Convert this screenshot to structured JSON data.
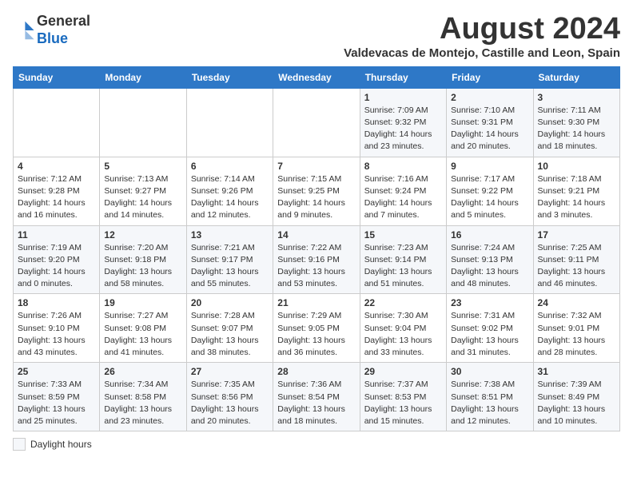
{
  "header": {
    "logo_general": "General",
    "logo_blue": "Blue",
    "main_title": "August 2024",
    "subtitle": "Valdevacas de Montejo, Castille and Leon, Spain"
  },
  "calendar": {
    "days_of_week": [
      "Sunday",
      "Monday",
      "Tuesday",
      "Wednesday",
      "Thursday",
      "Friday",
      "Saturday"
    ],
    "weeks": [
      [
        {
          "day": "",
          "info": ""
        },
        {
          "day": "",
          "info": ""
        },
        {
          "day": "",
          "info": ""
        },
        {
          "day": "",
          "info": ""
        },
        {
          "day": "1",
          "info": "Sunrise: 7:09 AM\nSunset: 9:32 PM\nDaylight: 14 hours and 23 minutes."
        },
        {
          "day": "2",
          "info": "Sunrise: 7:10 AM\nSunset: 9:31 PM\nDaylight: 14 hours and 20 minutes."
        },
        {
          "day": "3",
          "info": "Sunrise: 7:11 AM\nSunset: 9:30 PM\nDaylight: 14 hours and 18 minutes."
        }
      ],
      [
        {
          "day": "4",
          "info": "Sunrise: 7:12 AM\nSunset: 9:28 PM\nDaylight: 14 hours and 16 minutes."
        },
        {
          "day": "5",
          "info": "Sunrise: 7:13 AM\nSunset: 9:27 PM\nDaylight: 14 hours and 14 minutes."
        },
        {
          "day": "6",
          "info": "Sunrise: 7:14 AM\nSunset: 9:26 PM\nDaylight: 14 hours and 12 minutes."
        },
        {
          "day": "7",
          "info": "Sunrise: 7:15 AM\nSunset: 9:25 PM\nDaylight: 14 hours and 9 minutes."
        },
        {
          "day": "8",
          "info": "Sunrise: 7:16 AM\nSunset: 9:24 PM\nDaylight: 14 hours and 7 minutes."
        },
        {
          "day": "9",
          "info": "Sunrise: 7:17 AM\nSunset: 9:22 PM\nDaylight: 14 hours and 5 minutes."
        },
        {
          "day": "10",
          "info": "Sunrise: 7:18 AM\nSunset: 9:21 PM\nDaylight: 14 hours and 3 minutes."
        }
      ],
      [
        {
          "day": "11",
          "info": "Sunrise: 7:19 AM\nSunset: 9:20 PM\nDaylight: 14 hours and 0 minutes."
        },
        {
          "day": "12",
          "info": "Sunrise: 7:20 AM\nSunset: 9:18 PM\nDaylight: 13 hours and 58 minutes."
        },
        {
          "day": "13",
          "info": "Sunrise: 7:21 AM\nSunset: 9:17 PM\nDaylight: 13 hours and 55 minutes."
        },
        {
          "day": "14",
          "info": "Sunrise: 7:22 AM\nSunset: 9:16 PM\nDaylight: 13 hours and 53 minutes."
        },
        {
          "day": "15",
          "info": "Sunrise: 7:23 AM\nSunset: 9:14 PM\nDaylight: 13 hours and 51 minutes."
        },
        {
          "day": "16",
          "info": "Sunrise: 7:24 AM\nSunset: 9:13 PM\nDaylight: 13 hours and 48 minutes."
        },
        {
          "day": "17",
          "info": "Sunrise: 7:25 AM\nSunset: 9:11 PM\nDaylight: 13 hours and 46 minutes."
        }
      ],
      [
        {
          "day": "18",
          "info": "Sunrise: 7:26 AM\nSunset: 9:10 PM\nDaylight: 13 hours and 43 minutes."
        },
        {
          "day": "19",
          "info": "Sunrise: 7:27 AM\nSunset: 9:08 PM\nDaylight: 13 hours and 41 minutes."
        },
        {
          "day": "20",
          "info": "Sunrise: 7:28 AM\nSunset: 9:07 PM\nDaylight: 13 hours and 38 minutes."
        },
        {
          "day": "21",
          "info": "Sunrise: 7:29 AM\nSunset: 9:05 PM\nDaylight: 13 hours and 36 minutes."
        },
        {
          "day": "22",
          "info": "Sunrise: 7:30 AM\nSunset: 9:04 PM\nDaylight: 13 hours and 33 minutes."
        },
        {
          "day": "23",
          "info": "Sunrise: 7:31 AM\nSunset: 9:02 PM\nDaylight: 13 hours and 31 minutes."
        },
        {
          "day": "24",
          "info": "Sunrise: 7:32 AM\nSunset: 9:01 PM\nDaylight: 13 hours and 28 minutes."
        }
      ],
      [
        {
          "day": "25",
          "info": "Sunrise: 7:33 AM\nSunset: 8:59 PM\nDaylight: 13 hours and 25 minutes."
        },
        {
          "day": "26",
          "info": "Sunrise: 7:34 AM\nSunset: 8:58 PM\nDaylight: 13 hours and 23 minutes."
        },
        {
          "day": "27",
          "info": "Sunrise: 7:35 AM\nSunset: 8:56 PM\nDaylight: 13 hours and 20 minutes."
        },
        {
          "day": "28",
          "info": "Sunrise: 7:36 AM\nSunset: 8:54 PM\nDaylight: 13 hours and 18 minutes."
        },
        {
          "day": "29",
          "info": "Sunrise: 7:37 AM\nSunset: 8:53 PM\nDaylight: 13 hours and 15 minutes."
        },
        {
          "day": "30",
          "info": "Sunrise: 7:38 AM\nSunset: 8:51 PM\nDaylight: 13 hours and 12 minutes."
        },
        {
          "day": "31",
          "info": "Sunrise: 7:39 AM\nSunset: 8:49 PM\nDaylight: 13 hours and 10 minutes."
        }
      ]
    ]
  },
  "legend": {
    "label": "Daylight hours"
  }
}
